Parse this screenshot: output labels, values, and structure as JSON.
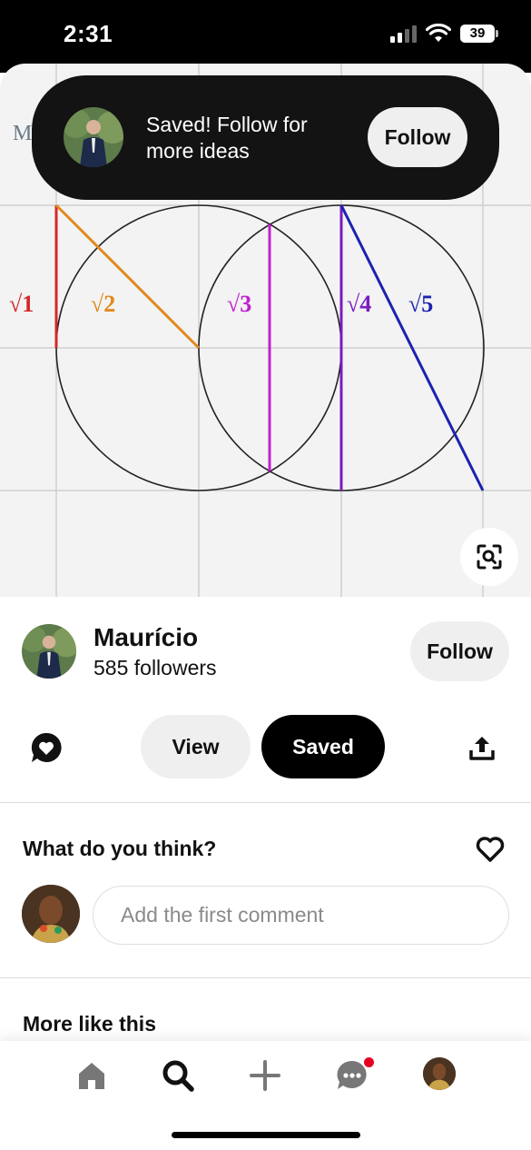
{
  "status_bar": {
    "time": "2:31",
    "battery": "39"
  },
  "pin": {
    "logo_text": "M",
    "labels": {
      "sqrt1": "√1",
      "sqrt2": "√2",
      "sqrt3": "√3",
      "sqrt4": "√4",
      "sqrt5": "√5"
    },
    "colors": {
      "sqrt1": "#d7262b",
      "sqrt2": "#e08a1c",
      "sqrt3": "#c21fd0",
      "sqrt4": "#7a1cc0",
      "sqrt5": "#1b22b0"
    }
  },
  "toast": {
    "message": "Saved! Follow for more ideas",
    "follow_label": "Follow"
  },
  "creator": {
    "name": "Maurício",
    "followers": "585 followers",
    "follow_label": "Follow"
  },
  "actions": {
    "view_label": "View",
    "saved_label": "Saved"
  },
  "comments": {
    "title": "What do you think?",
    "placeholder": "Add the first comment"
  },
  "more": {
    "title": "More like this"
  },
  "nav": {
    "icons": [
      "home-icon",
      "search-icon",
      "plus-icon",
      "messages-icon",
      "profile-avatar"
    ],
    "messages_has_notification": true
  }
}
